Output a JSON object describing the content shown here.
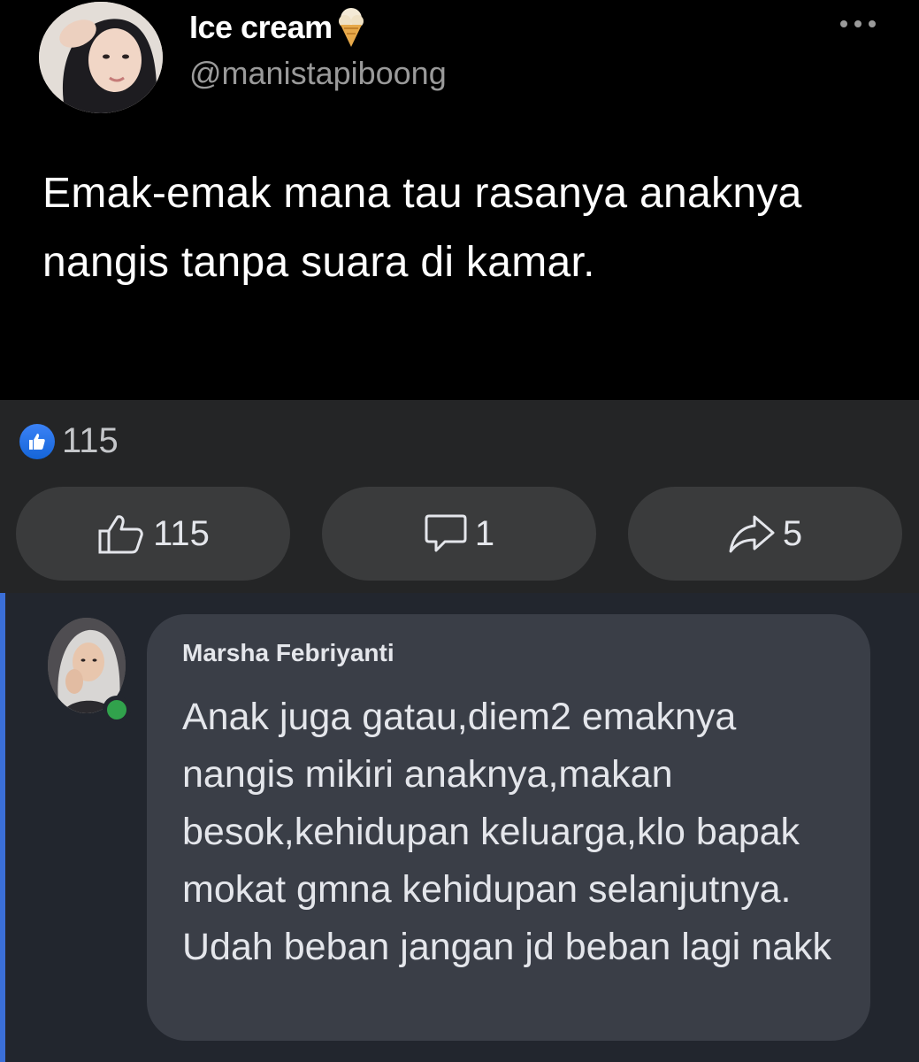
{
  "post": {
    "author_name": "Ice cream",
    "author_name_icon": "ice-cream-icon",
    "author_handle": "@manistapiboong",
    "more_icon": "more-dots-icon",
    "text": "Emak-emak mana tau rasanya anaknya nangis tanpa suara di kamar."
  },
  "reactions": {
    "summary_icon": "like-badge-icon",
    "summary_count": "115"
  },
  "actions": {
    "like": {
      "icon": "thumbs-up-icon",
      "count": "115"
    },
    "comment": {
      "icon": "comment-icon",
      "count": "1"
    },
    "share": {
      "icon": "share-arrow-icon",
      "count": "5"
    }
  },
  "comment": {
    "author_name": "Marsha Febriyanti",
    "online": true,
    "text": "Anak juga gatau,diem2 emaknya nangis mikiri anaknya,makan besok,kehidupan keluarga,klo bapak mokat gmna kehidupan selanjutnya. Udah beban jangan jd beban lagi nakk"
  },
  "colors": {
    "post_bg": "#000000",
    "actions_bg": "#242526",
    "pill_bg": "#3a3b3c",
    "comment_bg": "#22262e",
    "bubble_bg": "#3a3e47",
    "like_blue": "#1877f2",
    "online_green": "#31a24c",
    "accent_border": "#3b6fd8"
  }
}
